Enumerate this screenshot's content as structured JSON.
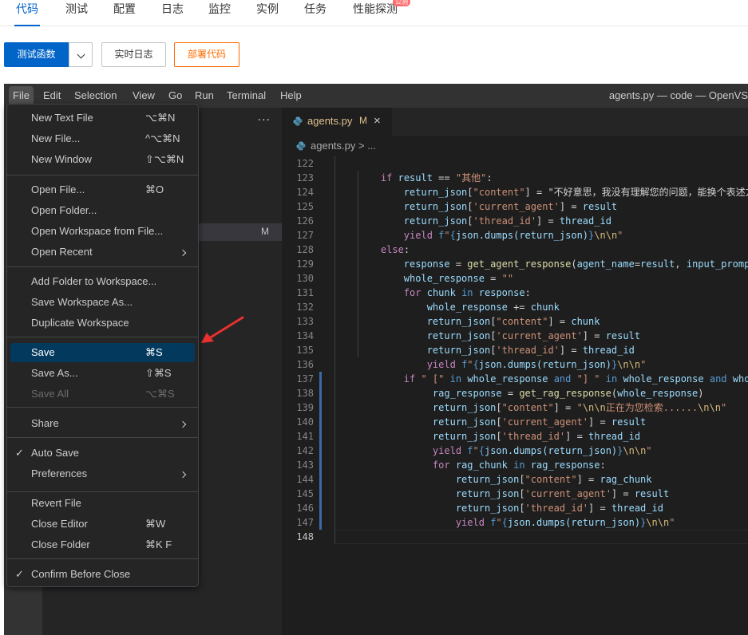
{
  "console": {
    "tabs": [
      {
        "label": "代码",
        "active": true
      },
      {
        "label": "测试"
      },
      {
        "label": "配置"
      },
      {
        "label": "日志"
      },
      {
        "label": "监控"
      },
      {
        "label": "实例"
      },
      {
        "label": "任务"
      },
      {
        "label": "性能探测",
        "badge": "公测"
      }
    ],
    "actions": {
      "test_function": "测试函数",
      "realtime_log": "实时日志",
      "deploy_code": "部署代码"
    },
    "accent_color": "#0064c8",
    "deploy_color": "#ff6a00"
  },
  "vscode": {
    "menubar": [
      "File",
      "Edit",
      "Selection",
      "View",
      "Go",
      "Run",
      "Terminal",
      "Help"
    ],
    "window_title": "agents.py — code — OpenVS",
    "sidebar_dots": "···",
    "sidebar_modified_marker": "M",
    "tab": {
      "name": "agents.py",
      "status": "M",
      "close": "×"
    },
    "breadcrumb": "agents.py > ...",
    "file_menu": [
      {
        "label": "New Text File",
        "key": "⌥⌘N"
      },
      {
        "label": "New File...",
        "key": "^⌥⌘N"
      },
      {
        "label": "New Window",
        "key": "⇧⌥⌘N"
      },
      {
        "label": "Open File...",
        "key": "⌘O"
      },
      {
        "label": "Open Folder...",
        "key": ""
      },
      {
        "label": "Open Workspace from File...",
        "key": ""
      },
      {
        "label": "Open Recent",
        "submenu": true
      },
      {
        "label": "Add Folder to Workspace...",
        "key": ""
      },
      {
        "label": "Save Workspace As...",
        "key": ""
      },
      {
        "label": "Duplicate Workspace",
        "key": ""
      },
      {
        "label": "Save",
        "key": "⌘S",
        "highlighted": true
      },
      {
        "label": "Save As...",
        "key": "⇧⌘S"
      },
      {
        "label": "Save All",
        "key": "⌥⌘S",
        "disabled": true
      },
      {
        "label": "Share",
        "submenu": true
      },
      {
        "label": "Auto Save",
        "checked": true
      },
      {
        "label": "Preferences",
        "submenu": true
      },
      {
        "label": "Revert File",
        "key": ""
      },
      {
        "label": "Close Editor",
        "key": "⌘W"
      },
      {
        "label": "Close Folder",
        "key": "⌘K F"
      },
      {
        "label": "Confirm Before Close",
        "checked": true
      }
    ],
    "check_mark": "✓",
    "code_lines": [
      {
        "n": "122",
        "text": ""
      },
      {
        "n": "123",
        "text": "    if result == \"其他\":"
      },
      {
        "n": "124",
        "text": "        return_json[\"content\"] = \"不好意思，我没有理解您的问题，能换个表述方式么"
      },
      {
        "n": "125",
        "text": "        return_json['current_agent'] = result"
      },
      {
        "n": "126",
        "text": "        return_json['thread_id'] = thread_id"
      },
      {
        "n": "127",
        "text": "        yield f\"{json.dumps(return_json)}\\n\\n\""
      },
      {
        "n": "128",
        "text": "    else:"
      },
      {
        "n": "129",
        "text": "        response = get_agent_response(agent_name=result, input_prompt=in"
      },
      {
        "n": "130",
        "text": "        whole_response = \"\""
      },
      {
        "n": "131",
        "text": "        for chunk in response:"
      },
      {
        "n": "132",
        "text": "            whole_response += chunk"
      },
      {
        "n": "133",
        "text": "            return_json[\"content\"] = chunk"
      },
      {
        "n": "134",
        "text": "            return_json['current_agent'] = result"
      },
      {
        "n": "135",
        "text": "            return_json['thread_id'] = thread_id"
      },
      {
        "n": "136",
        "text": "            yield f\"{json.dumps(return_json)}\\n\\n\""
      },
      {
        "n": "137",
        "text": "        if \" [\" in whole_response and \"] \" in whole_response and whole_re"
      },
      {
        "n": "138",
        "text": "             rag_response = get_rag_response(whole_response)"
      },
      {
        "n": "139",
        "text": "             return_json[\"content\"] = \"\\n\\n正在为您检索......\\n\\n\""
      },
      {
        "n": "140",
        "text": "             return_json['current_agent'] = result"
      },
      {
        "n": "141",
        "text": "             return_json['thread_id'] = thread_id"
      },
      {
        "n": "142",
        "text": "             yield f\"{json.dumps(return_json)}\\n\\n\""
      },
      {
        "n": "143",
        "text": "             for rag_chunk in rag_response:"
      },
      {
        "n": "144",
        "text": "                 return_json[\"content\"] = rag_chunk"
      },
      {
        "n": "145",
        "text": "                 return_json['current_agent'] = result"
      },
      {
        "n": "146",
        "text": "                 return_json['thread_id'] = thread_id"
      },
      {
        "n": "147",
        "text": "                 yield f\"{json.dumps(return_json)}\\n\\n\""
      },
      {
        "n": "148",
        "text": ""
      }
    ]
  }
}
